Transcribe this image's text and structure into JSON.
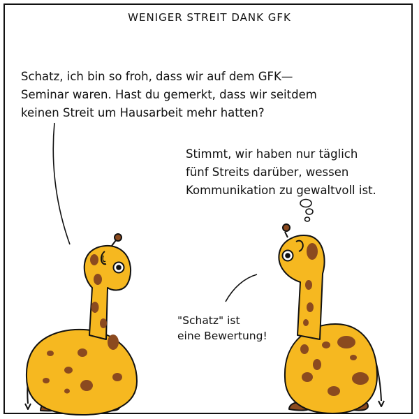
{
  "title": "WENIGER STREIT DANK GFK",
  "left_speech": {
    "lines": [
      "Schatz, ich bin so froh, dass wir auf dem GFK—",
      "Seminar waren. Hast du gemerkt, dass wir seitdem",
      "keinen Streit um Hausarbeit mehr hatten?"
    ]
  },
  "right_speech": {
    "lines": [
      "Stimmt, wir haben nur täglich",
      "fünf Streits darüber, wessen",
      "Kommunikation zu gewaltvoll ist."
    ]
  },
  "aside_speech": {
    "lines": [
      "\"Schatz\" ist",
      "eine Bewertung!"
    ]
  },
  "colors": {
    "giraffe_body": "#f6b820",
    "giraffe_spots": "#8b4a1f",
    "outline": "#111111"
  }
}
